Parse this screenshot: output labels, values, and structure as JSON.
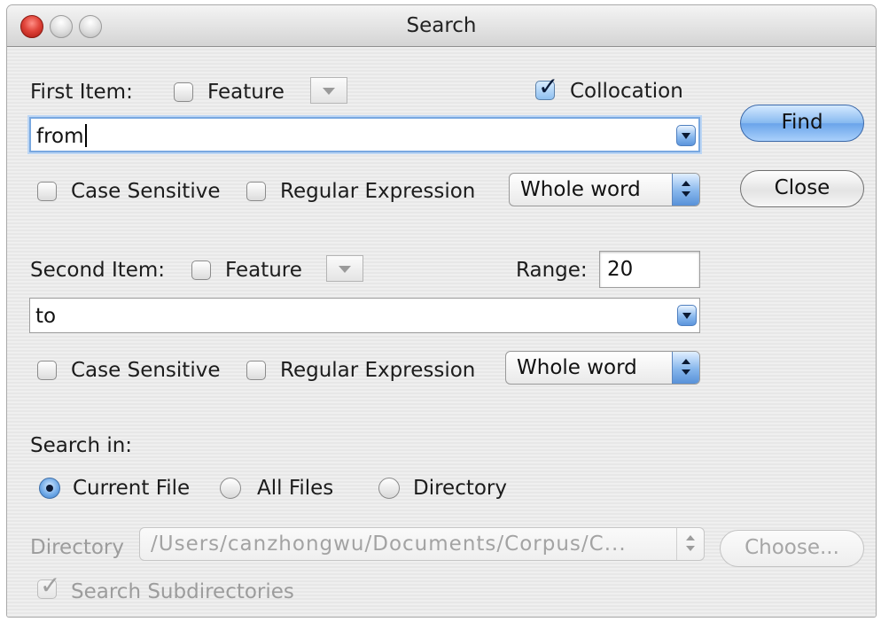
{
  "window": {
    "title": "Search"
  },
  "first_item": {
    "label": "First Item:",
    "feature_label": "Feature",
    "feature_checked": false,
    "collocation_label": "Collocation",
    "collocation_checked": true,
    "query_value": "from",
    "case_sensitive_label": "Case Sensitive",
    "case_sensitive_checked": false,
    "regex_label": "Regular Expression",
    "regex_checked": false,
    "match_mode": "Whole word"
  },
  "second_item": {
    "label": "Second Item:",
    "feature_label": "Feature",
    "feature_checked": false,
    "range_label": "Range:",
    "range_value": "20",
    "query_value": "to",
    "case_sensitive_label": "Case Sensitive",
    "case_sensitive_checked": false,
    "regex_label": "Regular Expression",
    "regex_checked": false,
    "match_mode": "Whole word"
  },
  "search_in": {
    "label": "Search in:",
    "options": [
      "Current File",
      "All Files",
      "Directory"
    ],
    "selected": "Current File"
  },
  "directory": {
    "label": "Directory",
    "path": "/Users/canzhongwu/Documents/Corpus/C...",
    "choose_label": "Choose...",
    "subdirectories_label": "Search Subdirectories",
    "subdirectories_checked": true,
    "enabled": false
  },
  "buttons": {
    "find_label": "Find",
    "close_label": "Close"
  },
  "icons": {
    "close": "close-window-icon",
    "minimize": "minimize-window-icon",
    "zoom": "zoom-window-icon",
    "dropdown": "chevron-down-icon",
    "stepper": "up-down-stepper-icon",
    "checkmark": "checkmark-icon"
  },
  "colors": {
    "accent": "#6aa4ea",
    "close_red": "#e0443a",
    "disabled_text": "#9c9c9c"
  }
}
